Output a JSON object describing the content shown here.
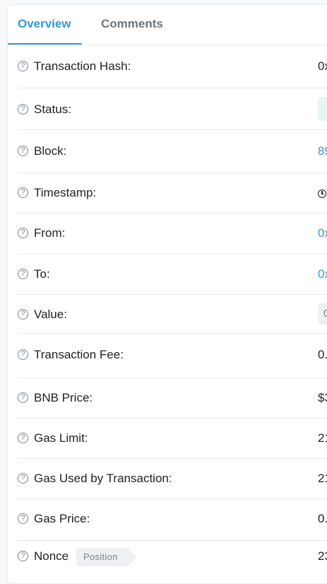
{
  "tabs": [
    {
      "label": "Overview",
      "active": true
    },
    {
      "label": "Comments",
      "active": false
    }
  ],
  "rows": {
    "tx_hash": {
      "label": "Transaction Hash:",
      "value": "0x"
    },
    "status": {
      "label": "Status:",
      "value": ""
    },
    "block": {
      "label": "Block:",
      "value": "89"
    },
    "timestamp": {
      "label": "Timestamp:",
      "value": ""
    },
    "from": {
      "label": "From:",
      "value": "0x"
    },
    "to": {
      "label": "To:",
      "value": "0x"
    },
    "value": {
      "label": "Value:",
      "value": "0"
    },
    "fee": {
      "label": "Transaction Fee:",
      "value": "0."
    },
    "bnb_price": {
      "label": "BNB Price:",
      "value": "$3"
    },
    "gas_limit": {
      "label": "Gas Limit:",
      "value": "21"
    },
    "gas_used": {
      "label": "Gas Used by Transaction:",
      "value": "21"
    },
    "gas_price": {
      "label": "Gas Price:",
      "value": "0."
    },
    "nonce": {
      "label": "Nonce",
      "badge": "Position",
      "value": "23"
    }
  },
  "help_icon_glyph": "?",
  "colors": {
    "accent": "#3498db",
    "status_bg": "#e6f6f2",
    "muted": "#77838f",
    "text": "#1e2022",
    "divider": "#e7eaf3"
  }
}
